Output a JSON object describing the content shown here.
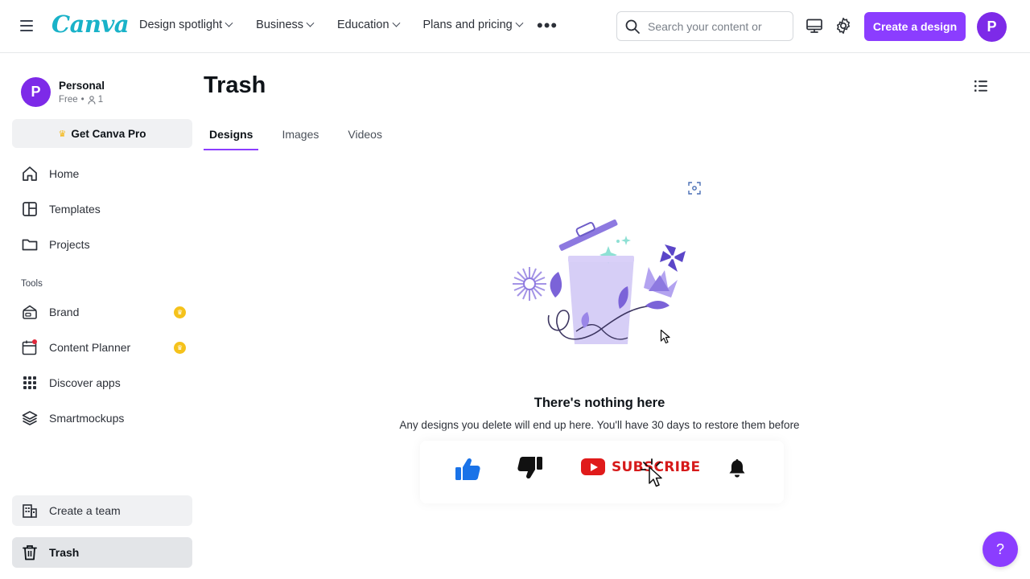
{
  "header": {
    "logo": "Canva",
    "nav": [
      {
        "label": "Design spotlight"
      },
      {
        "label": "Business"
      },
      {
        "label": "Education"
      },
      {
        "label": "Plans and pricing"
      }
    ],
    "more_icon": "more-horizontal-icon",
    "search_placeholder": "Search your content or",
    "create_button": "Create a design",
    "avatar_initial": "P",
    "colors": {
      "accent": "#8b3dff",
      "avatar": "#7d2ae8",
      "logo": "#19b2c8"
    }
  },
  "sidebar": {
    "account": {
      "initial": "P",
      "name": "Personal",
      "plan": "Free",
      "members": "1"
    },
    "pro_button": "Get Canva Pro",
    "items": [
      {
        "label": "Home",
        "icon": "home-icon"
      },
      {
        "label": "Templates",
        "icon": "templates-icon"
      },
      {
        "label": "Projects",
        "icon": "folder-icon"
      }
    ],
    "tools_heading": "Tools",
    "tools": [
      {
        "label": "Brand",
        "icon": "brand-icon",
        "pro": true
      },
      {
        "label": "Content Planner",
        "icon": "calendar-icon",
        "pro": true
      },
      {
        "label": "Discover apps",
        "icon": "apps-grid-icon",
        "pro": false
      },
      {
        "label": "Smartmockups",
        "icon": "layers-icon",
        "pro": false
      }
    ],
    "create_team": "Create a team",
    "trash": "Trash"
  },
  "main": {
    "title": "Trash",
    "tabs": [
      {
        "label": "Designs",
        "active": true
      },
      {
        "label": "Images",
        "active": false
      },
      {
        "label": "Videos",
        "active": false
      }
    ],
    "empty_title": "There's nothing here",
    "empty_description": "Any designs you delete will end up here. You'll have 30 days to restore them before"
  },
  "overlay": {
    "subscribe_label": "SUBSCRIBE"
  },
  "help_label": "?"
}
